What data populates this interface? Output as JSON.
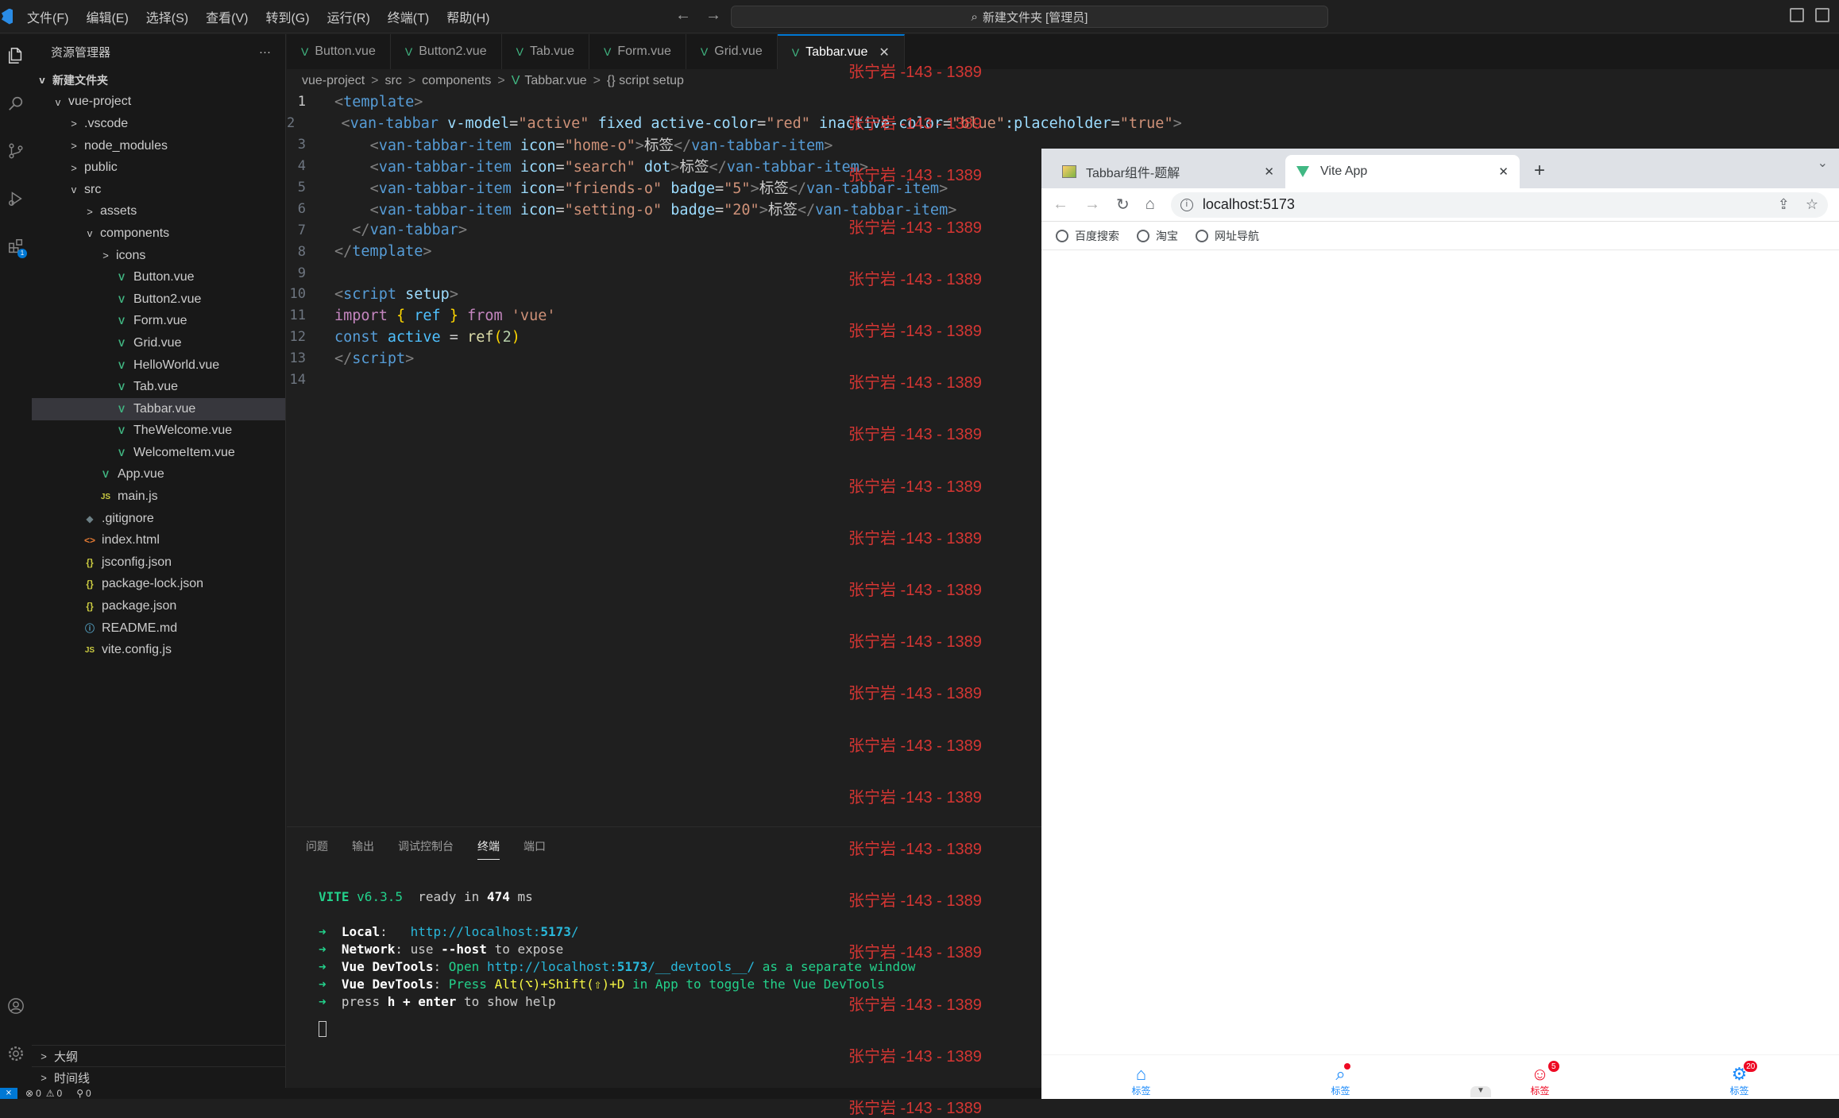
{
  "menu": [
    "文件(F)",
    "编辑(E)",
    "选择(S)",
    "查看(V)",
    "转到(G)",
    "运行(R)",
    "终端(T)",
    "帮助(H)"
  ],
  "command_center": "新建文件夹 [管理员]",
  "explorer": {
    "title": "资源管理器",
    "more": "···",
    "root": "新建文件夹",
    "rows": [
      {
        "label": "vue-project",
        "indent": 1,
        "twisty": "v",
        "icon": "",
        "cls": ""
      },
      {
        "label": ".vscode",
        "indent": 2,
        "twisty": ">",
        "icon": "",
        "cls": ""
      },
      {
        "label": "node_modules",
        "indent": 2,
        "twisty": ">",
        "icon": "",
        "cls": ""
      },
      {
        "label": "public",
        "indent": 2,
        "twisty": ">",
        "icon": "",
        "cls": ""
      },
      {
        "label": "src",
        "indent": 2,
        "twisty": "v",
        "icon": "",
        "cls": ""
      },
      {
        "label": "assets",
        "indent": 3,
        "twisty": ">",
        "icon": "",
        "cls": ""
      },
      {
        "label": "components",
        "indent": 3,
        "twisty": "v",
        "icon": "",
        "cls": ""
      },
      {
        "label": "icons",
        "indent": 4,
        "twisty": ">",
        "icon": "",
        "cls": ""
      },
      {
        "label": "Button.vue",
        "indent": 4,
        "twisty": "",
        "icon": "V",
        "cls": "vue"
      },
      {
        "label": "Button2.vue",
        "indent": 4,
        "twisty": "",
        "icon": "V",
        "cls": "vue"
      },
      {
        "label": "Form.vue",
        "indent": 4,
        "twisty": "",
        "icon": "V",
        "cls": "vue"
      },
      {
        "label": "Grid.vue",
        "indent": 4,
        "twisty": "",
        "icon": "V",
        "cls": "vue"
      },
      {
        "label": "HelloWorld.vue",
        "indent": 4,
        "twisty": "",
        "icon": "V",
        "cls": "vue"
      },
      {
        "label": "Tab.vue",
        "indent": 4,
        "twisty": "",
        "icon": "V",
        "cls": "vue"
      },
      {
        "label": "Tabbar.vue",
        "indent": 4,
        "twisty": "",
        "icon": "V",
        "cls": "vue",
        "selected": true
      },
      {
        "label": "TheWelcome.vue",
        "indent": 4,
        "twisty": "",
        "icon": "V",
        "cls": "vue"
      },
      {
        "label": "WelcomeItem.vue",
        "indent": 4,
        "twisty": "",
        "icon": "V",
        "cls": "vue"
      },
      {
        "label": "App.vue",
        "indent": 3,
        "twisty": "",
        "icon": "V",
        "cls": "vue"
      },
      {
        "label": "main.js",
        "indent": 3,
        "twisty": "",
        "icon": "JS",
        "cls": "js"
      },
      {
        "label": ".gitignore",
        "indent": 2,
        "twisty": "",
        "icon": "◆",
        "cls": "git"
      },
      {
        "label": "index.html",
        "indent": 2,
        "twisty": "",
        "icon": "<>",
        "cls": "html"
      },
      {
        "label": "jsconfig.json",
        "indent": 2,
        "twisty": "",
        "icon": "{}",
        "cls": "json"
      },
      {
        "label": "package-lock.json",
        "indent": 2,
        "twisty": "",
        "icon": "{}",
        "cls": "json"
      },
      {
        "label": "package.json",
        "indent": 2,
        "twisty": "",
        "icon": "{}",
        "cls": "json"
      },
      {
        "label": "README.md",
        "indent": 2,
        "twisty": "",
        "icon": "ⓘ",
        "cls": "info"
      },
      {
        "label": "vite.config.js",
        "indent": 2,
        "twisty": "",
        "icon": "JS",
        "cls": "js"
      }
    ],
    "outline": "大纲",
    "timeline": "时间线"
  },
  "tabs": [
    "Button.vue",
    "Button2.vue",
    "Tab.vue",
    "Form.vue",
    "Grid.vue",
    "Tabbar.vue"
  ],
  "active_tab": "Tabbar.vue",
  "breadcrumb": [
    "vue-project",
    "src",
    "components",
    "Tabbar.vue",
    "{} script setup"
  ],
  "code_lines": [
    "<span class=\"tg\">&lt;</span><span class=\"t\">template</span><span class=\"tg\">&gt;</span>",
    "  <span class=\"tg\">&lt;</span><span class=\"t\">van-tabbar</span> <span class=\"a\">v-model</span>=<span class=\"s\">\"active\"</span> <span class=\"a\">fixed</span> <span class=\"a\">active-color</span>=<span class=\"s\">\"red\"</span> <span class=\"a\">inactive-color</span>=<span class=\"s\">\"blue\"</span><span class=\"a\">:placeholder</span>=<span class=\"s\">\"true\"</span><span class=\"tg\">&gt;</span>",
    "    <span class=\"tg\">&lt;</span><span class=\"t\">van-tabbar-item</span> <span class=\"a\">icon</span>=<span class=\"s\">\"home-o\"</span><span class=\"tg\">&gt;</span>标签<span class=\"tg\">&lt;/</span><span class=\"t\">van-tabbar-item</span><span class=\"tg\">&gt;</span>",
    "    <span class=\"tg\">&lt;</span><span class=\"t\">van-tabbar-item</span> <span class=\"a\">icon</span>=<span class=\"s\">\"search\"</span> <span class=\"a\">dot</span><span class=\"tg\">&gt;</span>标签<span class=\"tg\">&lt;/</span><span class=\"t\">van-tabbar-item</span><span class=\"tg\">&gt;</span>",
    "    <span class=\"tg\">&lt;</span><span class=\"t\">van-tabbar-item</span> <span class=\"a\">icon</span>=<span class=\"s\">\"friends-o\"</span> <span class=\"a\">badge</span>=<span class=\"s\">\"5\"</span><span class=\"tg\">&gt;</span>标签<span class=\"tg\">&lt;/</span><span class=\"t\">van-tabbar-item</span><span class=\"tg\">&gt;</span>",
    "    <span class=\"tg\">&lt;</span><span class=\"t\">van-tabbar-item</span> <span class=\"a\">icon</span>=<span class=\"s\">\"setting-o\"</span> <span class=\"a\">badge</span>=<span class=\"s\">\"20\"</span><span class=\"tg\">&gt;</span>标签<span class=\"tg\">&lt;/</span><span class=\"t\">van-tabbar-item</span><span class=\"tg\">&gt;</span>",
    "  <span class=\"tg\">&lt;/</span><span class=\"t\">van-tabbar</span><span class=\"tg\">&gt;</span>",
    "<span class=\"tg\">&lt;/</span><span class=\"t\">template</span><span class=\"tg\">&gt;</span>",
    "",
    "<span class=\"tg\">&lt;</span><span class=\"t\">script</span> <span class=\"a\">setup</span><span class=\"tg\">&gt;</span>",
    "<span class=\"k\">import</span> <span class=\"b\">{</span> <span class=\"v\">ref</span> <span class=\"b\">}</span> <span class=\"k\">from</span> <span class=\"s\">'vue'</span>",
    "<span class=\"t\">const</span> <span class=\"v\">active</span> = <span class=\"f\">ref</span><span class=\"b\">(</span><span class=\"n\">2</span><span class=\"b\">)</span>",
    "<span class=\"tg\">&lt;/</span><span class=\"t\">script</span><span class=\"tg\">&gt;</span>",
    ""
  ],
  "panel_tabs": [
    "问题",
    "输出",
    "调试控制台",
    "终端",
    "端口"
  ],
  "active_panel_tab": "终端",
  "terminal_lines": [
    "<span class=\"grn\" style=\"font-weight:bold\">VITE</span> <span class=\"grn\">v6.3.5</span>  ready in <span class=\"bw\">474</span> ms",
    "",
    "<span class=\"grn\">➜</span>  <span class=\"bw\">Local</span>:   <span class=\"cy\">http://localhost:<span class=\"bw\" style=\"color:#29b8db\">5173</span>/</span>",
    "<span class=\"grn\">➜</span>  <span class=\"bw\">Network</span>: use <span class=\"bw\">--host</span> to expose",
    "<span class=\"grn\">➜</span>  <span class=\"bw\">Vue DevTools</span>: <span class=\"grn\">Open</span> <span class=\"cy\">http://localhost:<span class=\"bw\" style=\"color:#29b8db\">5173</span>/__devtools__/</span> <span class=\"grn\">as a separate window</span>",
    "<span class=\"grn\">➜</span>  <span class=\"bw\">Vue DevTools</span>: <span class=\"grn\">Press</span> <span class=\"yl\">Alt(⌥)+Shift(⇧)+D</span> <span class=\"grn\">in App to toggle the Vue DevTools</span>",
    "<span class=\"grn\">➜</span>  press <span class=\"bw\">h + enter</span> to show help"
  ],
  "watermark": "张宁岩 -143 - 1389",
  "status": {
    "errors": "0",
    "warnings": "0",
    "ports": "0"
  },
  "browser": {
    "tabs": [
      {
        "title": "Tabbar组件-题解"
      },
      {
        "title": "Vite App"
      }
    ],
    "url": "localhost:5173",
    "bookmarks": [
      "百度搜索",
      "淘宝",
      "网址导航"
    ]
  },
  "tabbar": {
    "items": [
      {
        "icon": "⌂",
        "label": "标签",
        "color": "blue",
        "dot": false,
        "badge": ""
      },
      {
        "icon": "⌕",
        "label": "标签",
        "color": "blue",
        "dot": true,
        "badge": ""
      },
      {
        "icon": "☺",
        "label": "标签",
        "color": "red",
        "dot": false,
        "badge": "5"
      },
      {
        "icon": "⚙",
        "label": "标签",
        "color": "blue",
        "dot": false,
        "badge": "20"
      }
    ],
    "active_index": 2,
    "active_color": "#ee0a24",
    "inactive_color": "#1989fa"
  }
}
